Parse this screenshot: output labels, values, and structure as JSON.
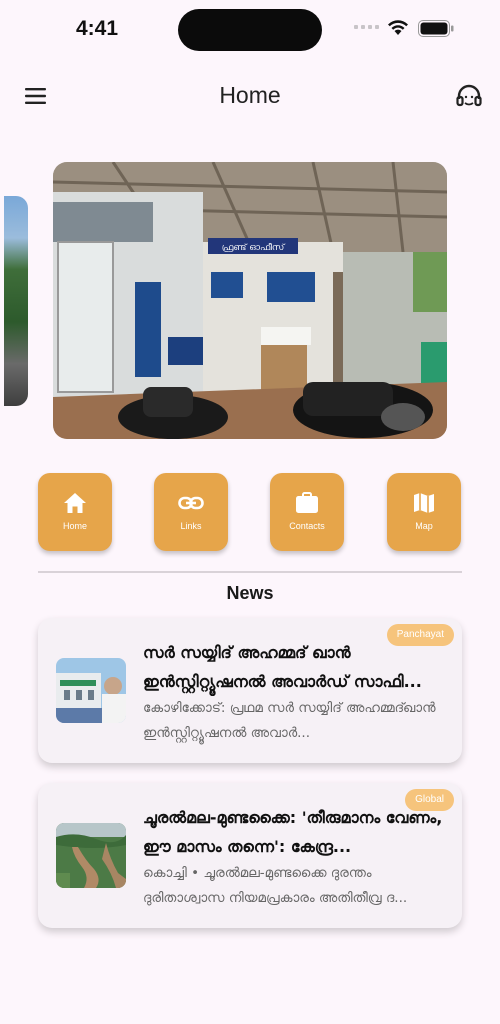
{
  "status_bar": {
    "time": "4:41"
  },
  "header": {
    "title": "Home",
    "menu_icon": "menu-icon",
    "support_icon": "headset-icon"
  },
  "carousel": {
    "sign_text": "ഫ്രണ്ട് ഓഫീസ്"
  },
  "quick_actions": [
    {
      "label": "Home",
      "icon": "home-icon"
    },
    {
      "label": "Links",
      "icon": "link-icon"
    },
    {
      "label": "Contacts",
      "icon": "briefcase-icon"
    },
    {
      "label": "Map",
      "icon": "map-icon"
    }
  ],
  "news": {
    "heading": "News",
    "items": [
      {
        "badge": "Panchayat",
        "title": "സർ സയ്യിദ് അഹമ്മദ് ഖാൻ ഇൻസ്റ്റിറ്റ്യൂഷനൽ അവാർഡ് സാഫി...",
        "description": "കോഴിക്കോട്: പ്രഥമ സർ സയ്യിദ് അഹമ്മദ്ഖാൻ ഇൻസ്റ്റിറ്റ്യൂഷനൽ അവാർ..."
      },
      {
        "badge": "Global",
        "title": "ചൂരൽമല-മുണ്ടക്കൈ: 'തീരുമാനം വേണം, ഈ മാസം തന്നെ': കേന്ദ്ര...",
        "description": "കൊച്ചി • ചൂരൽമല-മുണ്ടക്കൈ ദുരന്തം ദുരിതാശ്വാസ നിയമപ്രകാരം അതിതീവ്ര ദ..."
      }
    ]
  },
  "colors": {
    "background": "#fdf6fc",
    "accent": "#e6a54a",
    "badge": "#f6c47c",
    "card": "#f6f1f6"
  }
}
